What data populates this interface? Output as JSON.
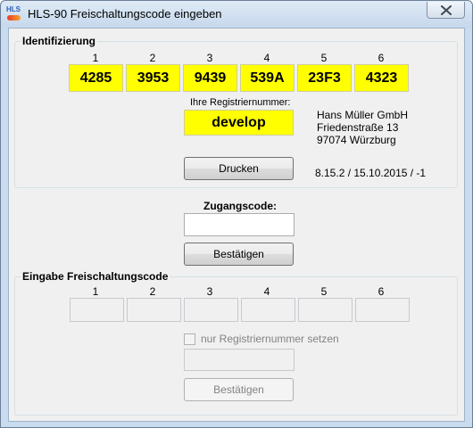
{
  "window": {
    "title": "HLS-90 Freischaltungscode eingeben",
    "icon_text": "HLS"
  },
  "identification": {
    "group_title": "Identifizierung",
    "columns": [
      "1",
      "2",
      "3",
      "4",
      "5",
      "6"
    ],
    "codes": [
      "4285",
      "3953",
      "9439",
      "539A",
      "23F3",
      "4323"
    ],
    "reg_label": "Ihre Registriernummer:",
    "reg_number": "develop",
    "address": [
      "Hans Müller GmbH",
      "Friedenstraße 13",
      "97074 Würzburg"
    ],
    "print_button": "Drucken",
    "version_info": "8.15.2  /  15.10.2015 / -1"
  },
  "access": {
    "label": "Zugangscode:",
    "value": "",
    "confirm_button": "Bestätigen"
  },
  "unlock": {
    "group_title": "Eingabe Freischaltungscode",
    "columns": [
      "1",
      "2",
      "3",
      "4",
      "5",
      "6"
    ],
    "fields": [
      "",
      "",
      "",
      "",
      "",
      ""
    ],
    "checkbox_label": "nur Registriernummer setzen",
    "checkbox_checked": false,
    "extra_field": "",
    "confirm_button": "Bestätigen"
  },
  "colors": {
    "code_highlight": "#ffff00",
    "window_frame": "#c9dbee",
    "client_bg": "#f0f0f0"
  }
}
